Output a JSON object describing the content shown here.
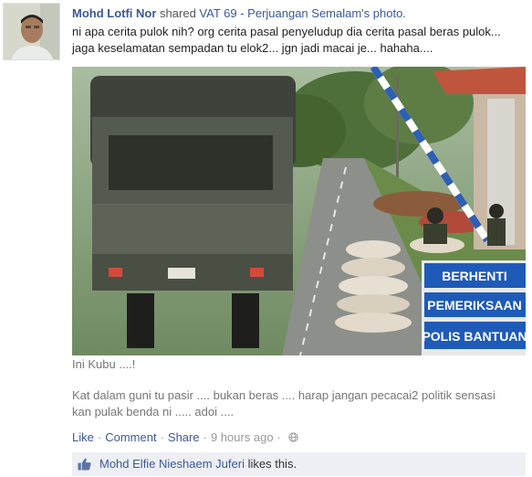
{
  "post": {
    "author": "Mohd Lotfi Nor",
    "action": "shared",
    "shared_from": "VAT 69 - Perjuangan Semalam's photo.",
    "message_line1": "ni apa cerita pulok nih? org cerita pasal penyeludup dia cerita pasal beras pulok...",
    "message_line2": "jaga keselamatan sempadan tu elok2... jgn jadi macai je... hahaha....",
    "photo": {
      "sign_line1": "BERHENTI",
      "sign_line2": "PEMERIKSAAN",
      "sign_line3": "POLIS BANTUAN"
    },
    "caption": "Ini Kubu ....!",
    "description_line1": "Kat dalam guni tu pasir .... bukan beras .... harap jangan pecacai2 politik sensasi",
    "description_line2": "kan pulak benda ni ..... adoi ....",
    "actions": {
      "like": "Like",
      "separator": "·",
      "comment": "Comment",
      "share": "Share",
      "timestamp": "9 hours ago",
      "privacy_icon": "globe-icon"
    },
    "likes": {
      "icon": "thumbs-up-icon",
      "liker": "Mohd Elfie Nieshaem Juferi",
      "suffix": "likes this."
    }
  },
  "colors": {
    "link": "#3b5998",
    "muted": "#777777",
    "likes_bg": "#edeff4",
    "sign_blue": "#1e5bb8"
  }
}
